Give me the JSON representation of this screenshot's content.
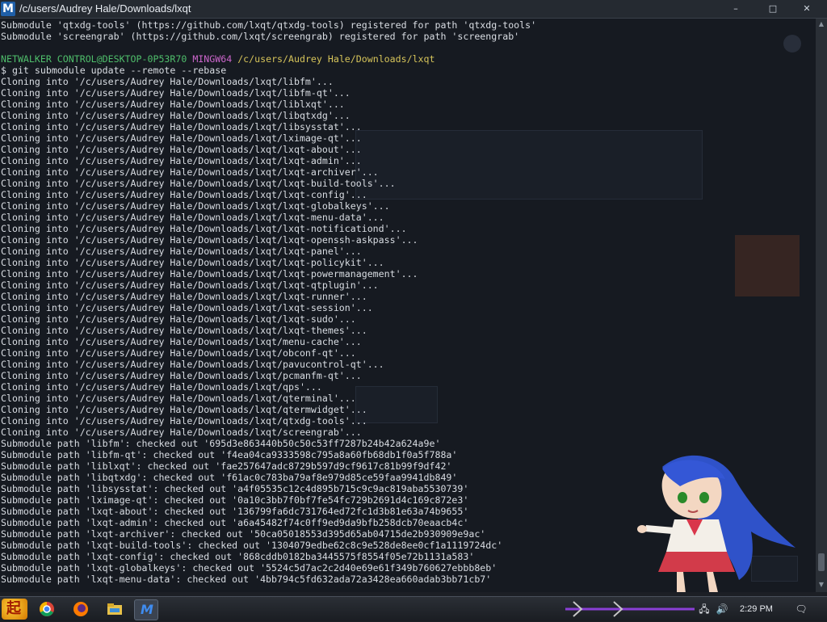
{
  "window": {
    "app_icon_letter": "M",
    "title": "/c/users/Audrey Hale/Downloads/lxqt",
    "minimize_glyph": "–",
    "maximize_glyph": "□",
    "close_glyph": "✕"
  },
  "terminal": {
    "lines": [
      "Submodule 'qtxdg-tools' (https://github.com/lxqt/qtxdg-tools) registered for path 'qtxdg-tools'",
      "Submodule 'screengrab' (https://github.com/lxqt/screengrab) registered for path 'screengrab'",
      "",
      "",
      "$ git submodule update --remote --rebase",
      "Cloning into '/c/users/Audrey Hale/Downloads/lxqt/libfm'...",
      "Cloning into '/c/users/Audrey Hale/Downloads/lxqt/libfm-qt'...",
      "Cloning into '/c/users/Audrey Hale/Downloads/lxqt/liblxqt'...",
      "Cloning into '/c/users/Audrey Hale/Downloads/lxqt/libqtxdg'...",
      "Cloning into '/c/users/Audrey Hale/Downloads/lxqt/libsysstat'...",
      "Cloning into '/c/users/Audrey Hale/Downloads/lxqt/lximage-qt'...",
      "Cloning into '/c/users/Audrey Hale/Downloads/lxqt/lxqt-about'...",
      "Cloning into '/c/users/Audrey Hale/Downloads/lxqt/lxqt-admin'...",
      "Cloning into '/c/users/Audrey Hale/Downloads/lxqt/lxqt-archiver'...",
      "Cloning into '/c/users/Audrey Hale/Downloads/lxqt/lxqt-build-tools'...",
      "Cloning into '/c/users/Audrey Hale/Downloads/lxqt/lxqt-config'...",
      "Cloning into '/c/users/Audrey Hale/Downloads/lxqt/lxqt-globalkeys'...",
      "Cloning into '/c/users/Audrey Hale/Downloads/lxqt/lxqt-menu-data'...",
      "Cloning into '/c/users/Audrey Hale/Downloads/lxqt/lxqt-notificationd'...",
      "Cloning into '/c/users/Audrey Hale/Downloads/lxqt/lxqt-openssh-askpass'...",
      "Cloning into '/c/users/Audrey Hale/Downloads/lxqt/lxqt-panel'...",
      "Cloning into '/c/users/Audrey Hale/Downloads/lxqt/lxqt-policykit'...",
      "Cloning into '/c/users/Audrey Hale/Downloads/lxqt/lxqt-powermanagement'...",
      "Cloning into '/c/users/Audrey Hale/Downloads/lxqt/lxqt-qtplugin'...",
      "Cloning into '/c/users/Audrey Hale/Downloads/lxqt/lxqt-runner'...",
      "Cloning into '/c/users/Audrey Hale/Downloads/lxqt/lxqt-session'...",
      "Cloning into '/c/users/Audrey Hale/Downloads/lxqt/lxqt-sudo'...",
      "Cloning into '/c/users/Audrey Hale/Downloads/lxqt/lxqt-themes'...",
      "Cloning into '/c/users/Audrey Hale/Downloads/lxqt/menu-cache'...",
      "Cloning into '/c/users/Audrey Hale/Downloads/lxqt/obconf-qt'...",
      "Cloning into '/c/users/Audrey Hale/Downloads/lxqt/pavucontrol-qt'...",
      "Cloning into '/c/users/Audrey Hale/Downloads/lxqt/pcmanfm-qt'...",
      "Cloning into '/c/users/Audrey Hale/Downloads/lxqt/qps'...",
      "Cloning into '/c/users/Audrey Hale/Downloads/lxqt/qterminal'...",
      "Cloning into '/c/users/Audrey Hale/Downloads/lxqt/qtermwidget'...",
      "Cloning into '/c/users/Audrey Hale/Downloads/lxqt/qtxdg-tools'...",
      "Cloning into '/c/users/Audrey Hale/Downloads/lxqt/screengrab'...",
      "Submodule path 'libfm': checked out '695d3e863440b50c50c53ff7287b24b42a624a9e'",
      "Submodule path 'libfm-qt': checked out 'f4ea04ca9333598c795a8a60fb68db1f0a5f788a'",
      "Submodule path 'liblxqt': checked out 'fae257647adc8729b597d9cf9617c81b99f9df42'",
      "Submodule path 'libqtxdg': checked out 'f61ac0c783ba79af8e979d85ce59faa9941db849'",
      "Submodule path 'libsysstat': checked out 'a4f05535c12c4d895b715c9c9ac819aba5530739'",
      "Submodule path 'lximage-qt': checked out '0a10c3bb7f0bf7fe54fc729b2691d4c169c872e3'",
      "Submodule path 'lxqt-about': checked out '136799fa6dc731764ed72fc1d3b81e63a74b9655'",
      "Submodule path 'lxqt-admin': checked out 'a6a45482f74c0ff9ed9da9bfb258dcb70eaacb4c'",
      "Submodule path 'lxqt-archiver': checked out '50ca05018553d395d65ab04715de2b930909e9ac'",
      "Submodule path 'lxqt-build-tools': checked out '1304079edbe62c8c9e528de8ee0cf1a1119724dc'",
      "Submodule path 'lxqt-config': checked out '868cddb0182ba3445575f8554f05e72b1131a583'",
      "Submodule path 'lxqt-globalkeys': checked out '5524c5d7ac2c2d40e69e61f349b760627ebbb8eb'",
      "Submodule path 'lxqt-menu-data': checked out '4bb794c5fd632ada72a3428ea660adab3bb71cb7'"
    ],
    "prompt": {
      "user_host": "NETWALKER CONTROL@DESKTOP-0P53R70",
      "shell": "MINGW64",
      "path": "/c/users/Audrey Hale/Downloads/lxqt"
    }
  },
  "taskbar": {
    "start_glyph": "起",
    "clock": "2:29 PM",
    "network_glyph": "🖧",
    "volume_glyph": "🔊",
    "notification_glyph": "🗨",
    "colors": {
      "start": "#e08a00",
      "chrome": "#db4437",
      "firefox": "#ff7b00",
      "explorer": "#e7c14a",
      "mingw": "#1f5fa8"
    }
  }
}
